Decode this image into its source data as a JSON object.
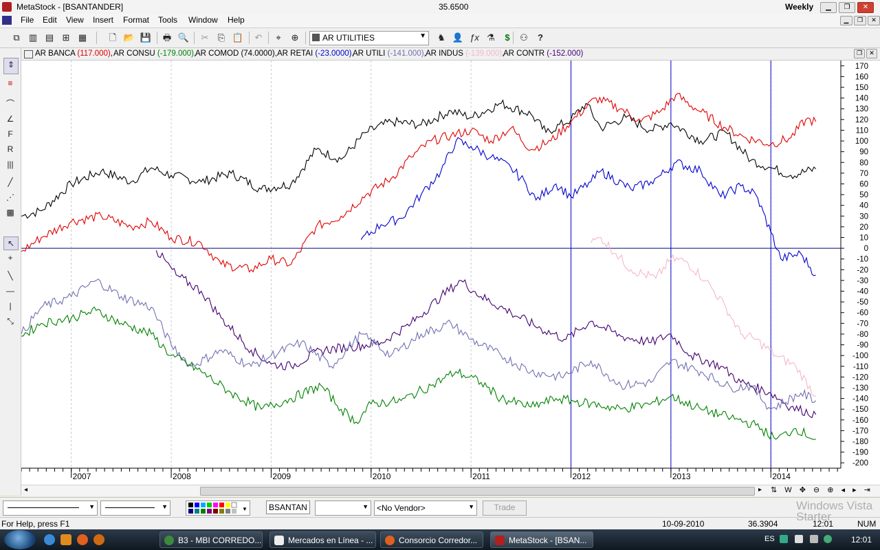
{
  "window": {
    "app_title": "MetaStock - [BSANTANDER]",
    "price": "35.6500",
    "periodicity": "Weekly",
    "min_icon": "minimize-icon",
    "restore_icon": "restore-icon",
    "close_icon": "close-icon"
  },
  "menu": [
    "File",
    "Edit",
    "View",
    "Insert",
    "Format",
    "Tools",
    "Window",
    "Help"
  ],
  "toolbar": {
    "security_combo": "AR UTILITIES"
  },
  "legend": [
    {
      "name": "AR BANCA",
      "value": "(117.000)",
      "color": "#e00000"
    },
    {
      "name": "AR CONSU",
      "value": "(-179.000)",
      "color": "#008000"
    },
    {
      "name": "AR COMOD",
      "value": "(74.0000)",
      "color": "#000000"
    },
    {
      "name": "AR RETAI",
      "value": "(-23.0000)",
      "color": "#0000cc"
    },
    {
      "name": "AR UTILI",
      "value": "(-141.000)",
      "color": "#7070b0"
    },
    {
      "name": "AR INDUS",
      "value": "(-139.000)",
      "color": "#f4b8c8"
    },
    {
      "name": "AR CONTR",
      "value": "(-152.000)",
      "color": "#400070"
    }
  ],
  "chart_data": {
    "type": "line",
    "ylim": [
      -205,
      175
    ],
    "yticks": [
      170,
      160,
      150,
      140,
      130,
      120,
      110,
      100,
      90,
      80,
      70,
      60,
      50,
      40,
      30,
      20,
      10,
      0,
      -10,
      -20,
      -30,
      -40,
      -50,
      -60,
      -70,
      -80,
      -90,
      -100,
      -110,
      -120,
      -130,
      -140,
      -150,
      -160,
      -170,
      -180,
      -190,
      -200
    ],
    "xlim": [
      2006.5,
      2014.7
    ],
    "xticks": [
      "2007",
      "2008",
      "2009",
      "2010",
      "2011",
      "2012",
      "2013",
      "2014"
    ],
    "vlines": [
      2012,
      2013,
      2014
    ],
    "hline": 0,
    "series": [
      {
        "name": "AR COMOD",
        "color": "#000000",
        "points": [
          [
            2006.5,
            30
          ],
          [
            2006.7,
            35
          ],
          [
            2007.0,
            60
          ],
          [
            2007.3,
            72
          ],
          [
            2007.6,
            62
          ],
          [
            2007.8,
            75
          ],
          [
            2008.0,
            68
          ],
          [
            2008.3,
            62
          ],
          [
            2008.6,
            70
          ],
          [
            2008.9,
            55
          ],
          [
            2009.2,
            60
          ],
          [
            2009.45,
            92
          ],
          [
            2009.7,
            83
          ],
          [
            2009.95,
            108
          ],
          [
            2010.2,
            118
          ],
          [
            2010.5,
            115
          ],
          [
            2010.8,
            128
          ],
          [
            2011.0,
            122
          ],
          [
            2011.3,
            135
          ],
          [
            2011.6,
            125
          ],
          [
            2011.75,
            108
          ],
          [
            2012.0,
            120
          ],
          [
            2012.15,
            135
          ],
          [
            2012.3,
            112
          ],
          [
            2012.55,
            122
          ],
          [
            2012.8,
            110
          ],
          [
            2013.0,
            117
          ],
          [
            2013.3,
            100
          ],
          [
            2013.55,
            108
          ],
          [
            2013.8,
            82
          ],
          [
            2014.0,
            75
          ],
          [
            2014.2,
            68
          ],
          [
            2014.45,
            74
          ]
        ]
      },
      {
        "name": "AR BANCA",
        "color": "#e00000",
        "points": [
          [
            2006.5,
            -3
          ],
          [
            2006.7,
            10
          ],
          [
            2007.0,
            25
          ],
          [
            2007.3,
            30
          ],
          [
            2007.6,
            20
          ],
          [
            2007.8,
            25
          ],
          [
            2008.0,
            10
          ],
          [
            2008.3,
            5
          ],
          [
            2008.5,
            -15
          ],
          [
            2008.8,
            -20
          ],
          [
            2009.0,
            -10
          ],
          [
            2009.2,
            -15
          ],
          [
            2009.45,
            20
          ],
          [
            2009.7,
            30
          ],
          [
            2009.95,
            50
          ],
          [
            2010.2,
            65
          ],
          [
            2010.4,
            85
          ],
          [
            2010.6,
            100
          ],
          [
            2010.8,
            105
          ],
          [
            2011.0,
            110
          ],
          [
            2011.2,
            100
          ],
          [
            2011.4,
            112
          ],
          [
            2011.6,
            92
          ],
          [
            2011.8,
            100
          ],
          [
            2012.0,
            118
          ],
          [
            2012.25,
            140
          ],
          [
            2012.5,
            130
          ],
          [
            2012.7,
            118
          ],
          [
            2012.9,
            128
          ],
          [
            2013.05,
            143
          ],
          [
            2013.3,
            127
          ],
          [
            2013.55,
            112
          ],
          [
            2013.75,
            103
          ],
          [
            2014.0,
            97
          ],
          [
            2014.2,
            103
          ],
          [
            2014.35,
            120
          ],
          [
            2014.45,
            118
          ]
        ]
      },
      {
        "name": "AR RETAI",
        "color": "#0000cc",
        "points": [
          [
            2009.9,
            8
          ],
          [
            2010.1,
            22
          ],
          [
            2010.3,
            28
          ],
          [
            2010.5,
            50
          ],
          [
            2010.7,
            72
          ],
          [
            2010.85,
            100
          ],
          [
            2011.0,
            95
          ],
          [
            2011.2,
            85
          ],
          [
            2011.4,
            75
          ],
          [
            2011.55,
            60
          ],
          [
            2011.65,
            45
          ],
          [
            2011.85,
            60
          ],
          [
            2012.0,
            48
          ],
          [
            2012.2,
            62
          ],
          [
            2012.3,
            72
          ],
          [
            2012.6,
            55
          ],
          [
            2012.8,
            62
          ],
          [
            2012.9,
            68
          ],
          [
            2013.05,
            80
          ],
          [
            2013.3,
            72
          ],
          [
            2013.5,
            48
          ],
          [
            2013.7,
            58
          ],
          [
            2013.85,
            50
          ],
          [
            2014.0,
            15
          ],
          [
            2014.1,
            -10
          ],
          [
            2014.3,
            -5
          ],
          [
            2014.45,
            -25
          ]
        ]
      },
      {
        "name": "AR INDUS",
        "color": "#f4b8c8",
        "points": [
          [
            2012.2,
            5
          ],
          [
            2012.3,
            10
          ],
          [
            2012.45,
            -5
          ],
          [
            2012.6,
            -20
          ],
          [
            2012.85,
            -28
          ],
          [
            2013.0,
            -10
          ],
          [
            2013.15,
            -12
          ],
          [
            2013.35,
            -30
          ],
          [
            2013.55,
            -55
          ],
          [
            2013.7,
            -80
          ],
          [
            2013.85,
            -85
          ],
          [
            2014.05,
            -100
          ],
          [
            2014.25,
            -110
          ],
          [
            2014.45,
            -138
          ]
        ]
      },
      {
        "name": "AR CONTR",
        "color": "#400070",
        "points": [
          [
            2007.85,
            -2
          ],
          [
            2008.05,
            -25
          ],
          [
            2008.3,
            -40
          ],
          [
            2008.5,
            -65
          ],
          [
            2008.8,
            -95
          ],
          [
            2009.0,
            -108
          ],
          [
            2009.2,
            -110
          ],
          [
            2009.5,
            -95
          ],
          [
            2009.8,
            -92
          ],
          [
            2010.1,
            -88
          ],
          [
            2010.4,
            -70
          ],
          [
            2010.7,
            -45
          ],
          [
            2010.9,
            -30
          ],
          [
            2011.1,
            -45
          ],
          [
            2011.4,
            -60
          ],
          [
            2011.7,
            -75
          ],
          [
            2011.95,
            -85
          ],
          [
            2012.2,
            -68
          ],
          [
            2012.5,
            -82
          ],
          [
            2012.8,
            -88
          ],
          [
            2013.0,
            -80
          ],
          [
            2013.2,
            -100
          ],
          [
            2013.5,
            -110
          ],
          [
            2013.7,
            -125
          ],
          [
            2014.0,
            -135
          ],
          [
            2014.2,
            -148
          ],
          [
            2014.45,
            -155
          ]
        ]
      },
      {
        "name": "AR UTILI",
        "color": "#7070b0",
        "points": [
          [
            2006.5,
            -80
          ],
          [
            2006.7,
            -55
          ],
          [
            2007.0,
            -45
          ],
          [
            2007.25,
            -30
          ],
          [
            2007.5,
            -45
          ],
          [
            2007.8,
            -55
          ],
          [
            2008.0,
            -90
          ],
          [
            2008.2,
            -110
          ],
          [
            2008.5,
            -95
          ],
          [
            2008.8,
            -110
          ],
          [
            2009.0,
            -100
          ],
          [
            2009.3,
            -88
          ],
          [
            2009.6,
            -110
          ],
          [
            2009.9,
            -80
          ],
          [
            2010.2,
            -100
          ],
          [
            2010.5,
            -80
          ],
          [
            2010.8,
            -70
          ],
          [
            2011.0,
            -85
          ],
          [
            2011.3,
            -100
          ],
          [
            2011.6,
            -115
          ],
          [
            2011.9,
            -120
          ],
          [
            2012.2,
            -105
          ],
          [
            2012.5,
            -128
          ],
          [
            2012.8,
            -125
          ],
          [
            2013.0,
            -105
          ],
          [
            2013.3,
            -115
          ],
          [
            2013.6,
            -130
          ],
          [
            2013.8,
            -128
          ],
          [
            2014.0,
            -150
          ],
          [
            2014.3,
            -135
          ],
          [
            2014.45,
            -142
          ]
        ]
      },
      {
        "name": "AR CONSU",
        "color": "#008000",
        "points": [
          [
            2006.5,
            -82
          ],
          [
            2006.7,
            -70
          ],
          [
            2007.0,
            -65
          ],
          [
            2007.25,
            -58
          ],
          [
            2007.5,
            -70
          ],
          [
            2007.8,
            -80
          ],
          [
            2008.0,
            -100
          ],
          [
            2008.3,
            -115
          ],
          [
            2008.6,
            -135
          ],
          [
            2008.9,
            -150
          ],
          [
            2009.2,
            -140
          ],
          [
            2009.5,
            -128
          ],
          [
            2009.7,
            -150
          ],
          [
            2009.85,
            -162
          ],
          [
            2010.0,
            -145
          ],
          [
            2010.3,
            -142
          ],
          [
            2010.6,
            -128
          ],
          [
            2010.85,
            -115
          ],
          [
            2011.1,
            -125
          ],
          [
            2011.3,
            -140
          ],
          [
            2011.6,
            -148
          ],
          [
            2011.85,
            -140
          ],
          [
            2012.2,
            -145
          ],
          [
            2012.5,
            -150
          ],
          [
            2012.8,
            -145
          ],
          [
            2013.0,
            -138
          ],
          [
            2013.3,
            -150
          ],
          [
            2013.6,
            -158
          ],
          [
            2013.85,
            -165
          ],
          [
            2014.05,
            -178
          ],
          [
            2014.25,
            -168
          ],
          [
            2014.45,
            -178
          ]
        ]
      }
    ]
  },
  "bottom": {
    "symbol_field": "BSANTAND",
    "vendor_select": "<No Vendor>",
    "trade_button": "Trade"
  },
  "status": {
    "help": "For Help, press F1",
    "date": "10-09-2010",
    "value": "36.3904",
    "time": "12:01",
    "num": "NUM"
  },
  "taskbar": {
    "tasks": [
      "B3 - MBI CORREDO...",
      "Mercados en Línea - ...",
      "Consorcio Corredor...",
      "MetaStock - [BSAN..."
    ],
    "lang": "ES",
    "clock": "12:01",
    "watermark1": "Windows Vista",
    "watermark2": "Starter"
  }
}
